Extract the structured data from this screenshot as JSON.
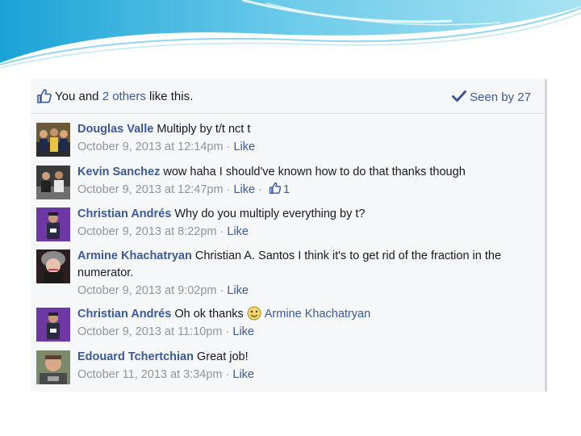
{
  "likes": {
    "prefix": "You and ",
    "others_link": "2 others",
    "suffix": " like this.",
    "seen": "Seen by 27"
  },
  "comments": [
    {
      "author": "Douglas Valle",
      "text": " Multiply by t/t nct t",
      "timestamp": "October 9, 2013 at 12:14pm",
      "sep": " · ",
      "like_label": "Like"
    },
    {
      "author": "Kevin Sanchez",
      "text": " wow haha I should've known how to do that thanks though",
      "timestamp": "October 9, 2013 at 12:47pm",
      "sep": " · ",
      "like_label": "Like",
      "sep2": " · ",
      "like_count": "1"
    },
    {
      "author": "Christian Andrés",
      "text": " Why do you multiply everything by t?",
      "timestamp": "October 9, 2013 at 8:22pm",
      "sep": " · ",
      "like_label": "Like"
    },
    {
      "author": "Armine Khachatryan",
      "text": " Christian A. Santos I think it's to get rid of the fraction in the numerator.",
      "timestamp": "October 9, 2013 at 9:02pm",
      "sep": " · ",
      "like_label": "Like"
    },
    {
      "author": "Christian Andrés",
      "text": " Oh ok thanks",
      "mention": "Armine Khachatryan",
      "timestamp": "October 9, 2013 at 11:10pm",
      "sep": " · ",
      "like_label": "Like"
    },
    {
      "author": "Edouard Tchertchian",
      "text": " Great job!",
      "timestamp": "October 11, 2013 at 3:34pm",
      "sep": " · ",
      "like_label": "Like"
    }
  ],
  "colors": {
    "link": "#3b5998",
    "meta": "#90949c",
    "panel_bg": "#f6f7f9",
    "swoosh": "#5bc0de"
  },
  "icons": {
    "like": "thumbs-up-icon",
    "seen": "checkmark-icon",
    "emoticon": "smiley-icon"
  }
}
